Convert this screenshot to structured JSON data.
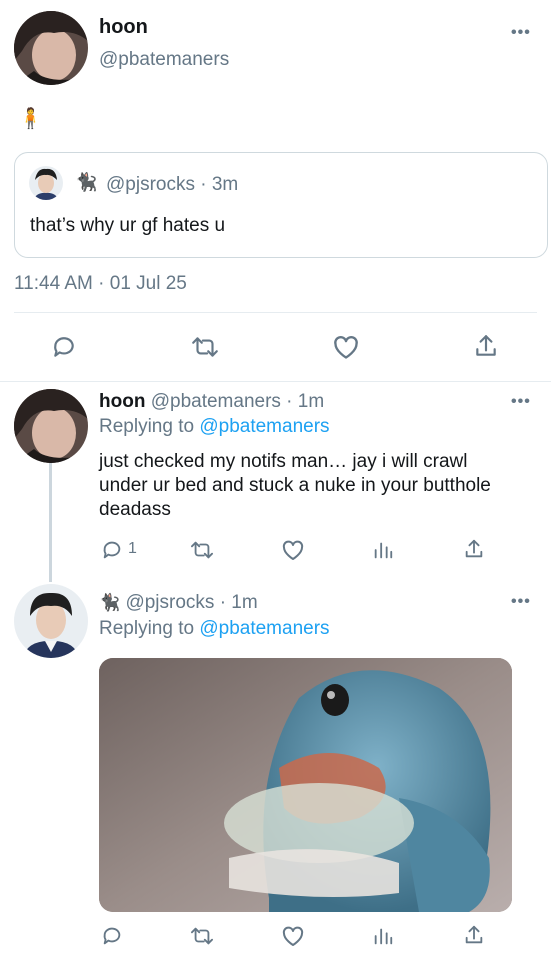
{
  "main_tweet": {
    "display_name": "hoon",
    "handle": "@pbatemaners",
    "body_emoji": "🧍",
    "timestamp": "11:44 AM · 01 Jul 25",
    "more_label": "•••"
  },
  "quoted_tweet": {
    "cat_emoji": "🐈‍⬛",
    "handle_time": "@pjsrocks · 3m",
    "text": "that’s why ur gf hates u"
  },
  "reply1": {
    "display_name": "hoon",
    "handle_time": "@pbatemaners · 1m",
    "replying_prefix": "Replying to",
    "replying_to": "@pbatemaners",
    "text": "just checked my notifs man… jay i will crawl under ur bed and stuck a nuke in your butthole deadass",
    "reply_count": "1",
    "more_label": "•••"
  },
  "reply2": {
    "cat_emoji": "🐈‍⬛",
    "handle_time": "@pjsrocks · 1m",
    "replying_prefix": "Replying to",
    "replying_to": "@pbatemaners",
    "more_label": "•••"
  },
  "colors": {
    "accent": "#1da1f2",
    "muted": "#657786",
    "divider": "#e6ecf0"
  },
  "icons": [
    "reply-icon",
    "retweet-icon",
    "like-icon",
    "share-icon",
    "analytics-icon",
    "more-icon"
  ]
}
